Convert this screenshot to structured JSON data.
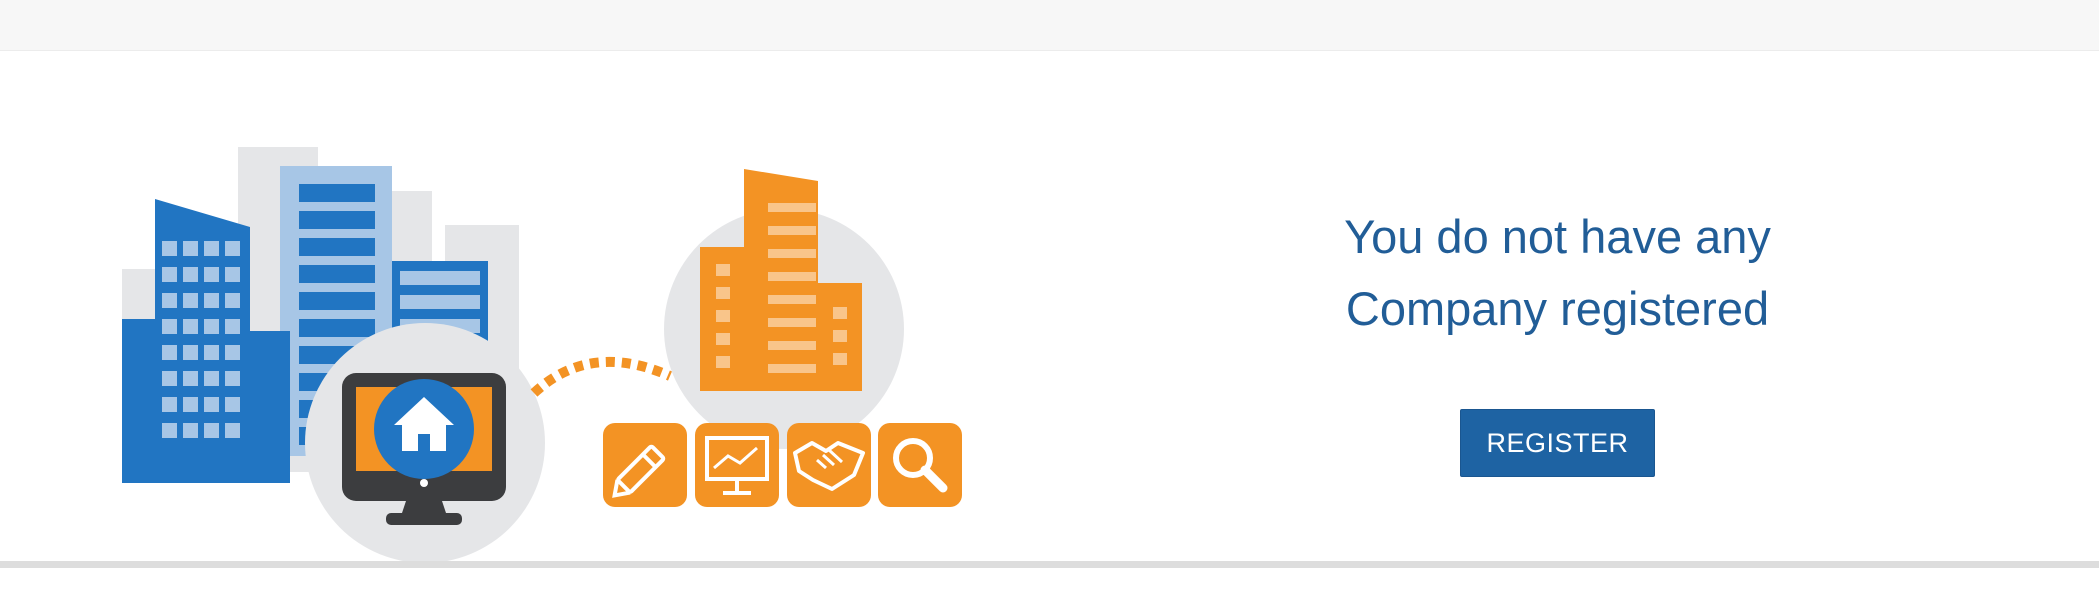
{
  "empty_state": {
    "message_line1": "You do not have any",
    "message_line2": "Company registered",
    "register_button_label": "REGISTER"
  },
  "illustration": {
    "icons": [
      "building-icon",
      "monitor-home-icon",
      "pencil-icon",
      "presentation-chart-icon",
      "handshake-icon",
      "magnifier-icon"
    ]
  },
  "colors": {
    "accent_blue": "#1e63a3",
    "message_text": "#215d97",
    "illustration_blue": "#2175c2",
    "illustration_orange": "#f39324"
  }
}
